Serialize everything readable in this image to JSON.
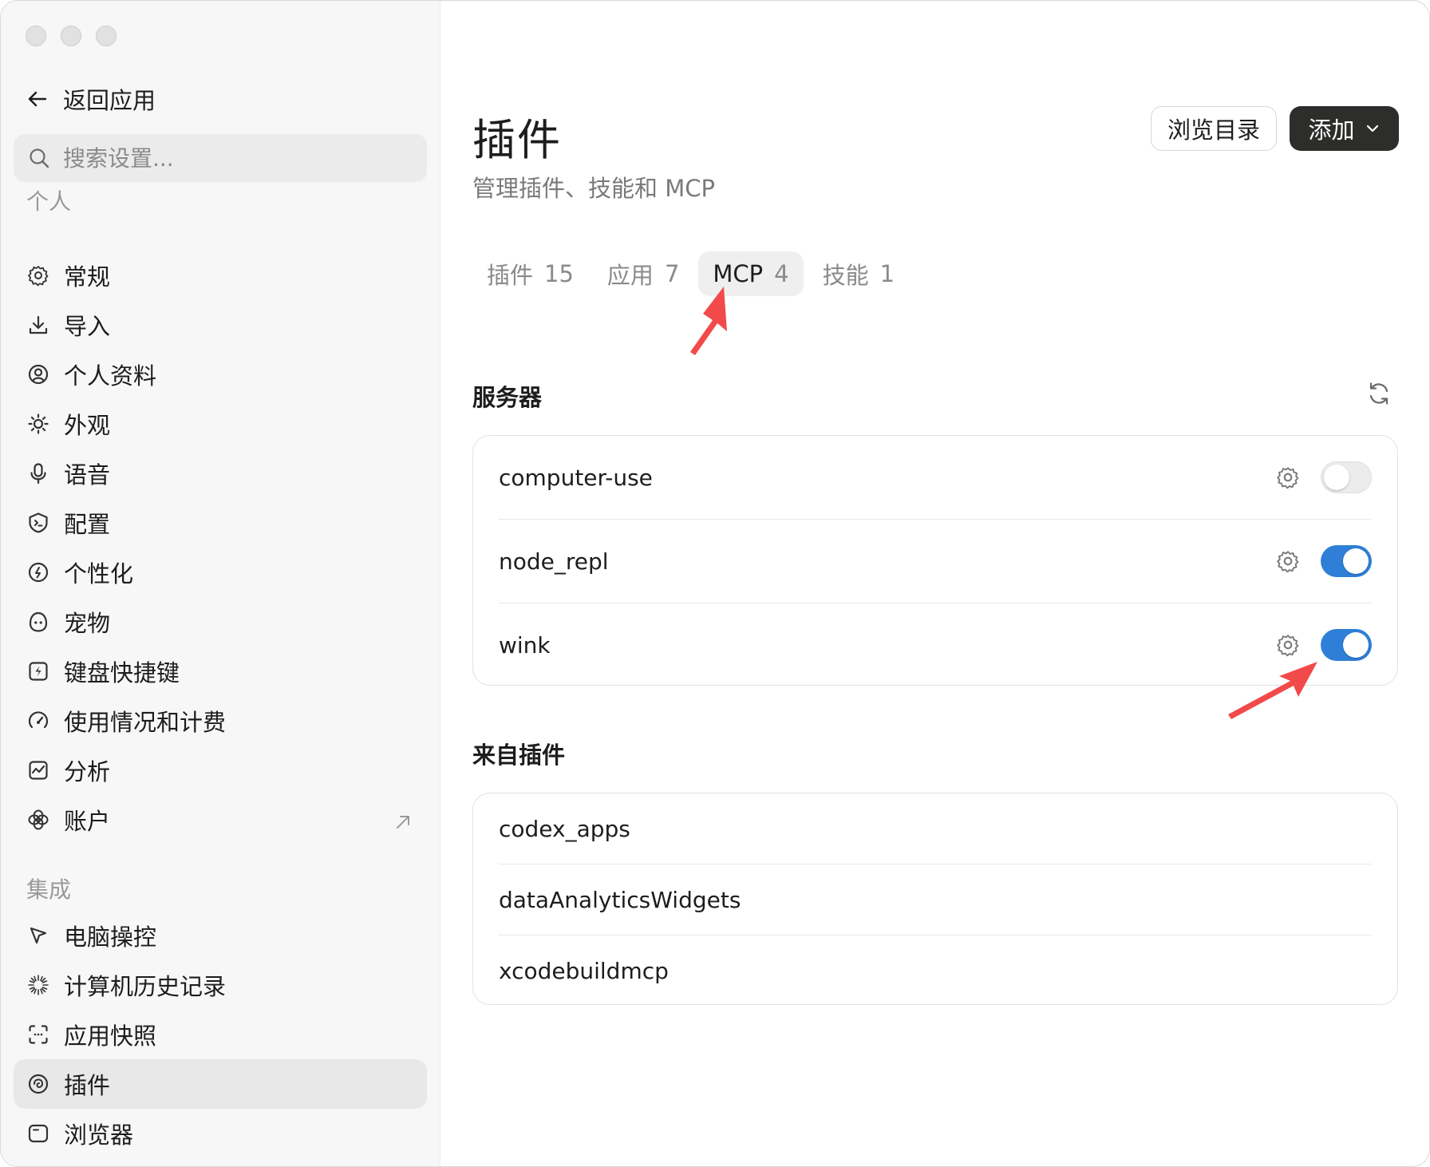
{
  "sidebar": {
    "back_label": "返回应用",
    "search_placeholder": "搜索设置...",
    "personal_label": "个人",
    "personal_items": [
      {
        "label": "常规",
        "icon": "gear-icon"
      },
      {
        "label": "导入",
        "icon": "download-icon"
      },
      {
        "label": "个人资料",
        "icon": "profile-icon"
      },
      {
        "label": "外观",
        "icon": "sun-icon"
      },
      {
        "label": "语音",
        "icon": "microphone-icon"
      },
      {
        "label": "配置",
        "icon": "terminal-shield-icon"
      },
      {
        "label": "个性化",
        "icon": "personalize-icon"
      },
      {
        "label": "宠物",
        "icon": "pet-icon"
      },
      {
        "label": "键盘快捷键",
        "icon": "keyboard-shortcut-icon"
      },
      {
        "label": "使用情况和计费",
        "icon": "gauge-icon"
      },
      {
        "label": "分析",
        "icon": "chart-icon"
      },
      {
        "label": "账户",
        "icon": "account-icon",
        "external": "external-link-icon"
      }
    ],
    "integrations_label": "集成",
    "integration_items": [
      {
        "label": "电脑操控",
        "icon": "cursor-icon"
      },
      {
        "label": "计算机历史记录",
        "icon": "sparkle-icon"
      },
      {
        "label": "应用快照",
        "icon": "snapshot-icon"
      },
      {
        "label": "插件",
        "icon": "plugin-icon",
        "active": true
      },
      {
        "label": "浏览器",
        "icon": "browser-icon"
      }
    ]
  },
  "main": {
    "title": "插件",
    "subtitle": "管理插件、技能和 MCP",
    "browse_button": "浏览目录",
    "add_button": "添加",
    "tabs": [
      {
        "label": "插件",
        "count": "15"
      },
      {
        "label": "应用",
        "count": "7"
      },
      {
        "label": "MCP",
        "count": "4",
        "active": true
      },
      {
        "label": "技能",
        "count": "1"
      }
    ],
    "servers_title": "服务器",
    "servers": [
      {
        "name": "computer-use",
        "enabled": false
      },
      {
        "name": "node_repl",
        "enabled": true
      },
      {
        "name": "wink",
        "enabled": true
      }
    ],
    "from_plugins_title": "来自插件",
    "plugin_servers": [
      "codex_apps",
      "dataAnalyticsWidgets",
      "xcodebuildmcp"
    ]
  },
  "colors": {
    "toggle_on": "#2f7fd8",
    "add_button_bg": "#2d2d2b",
    "annotation_arrow": "#f24a4a"
  }
}
